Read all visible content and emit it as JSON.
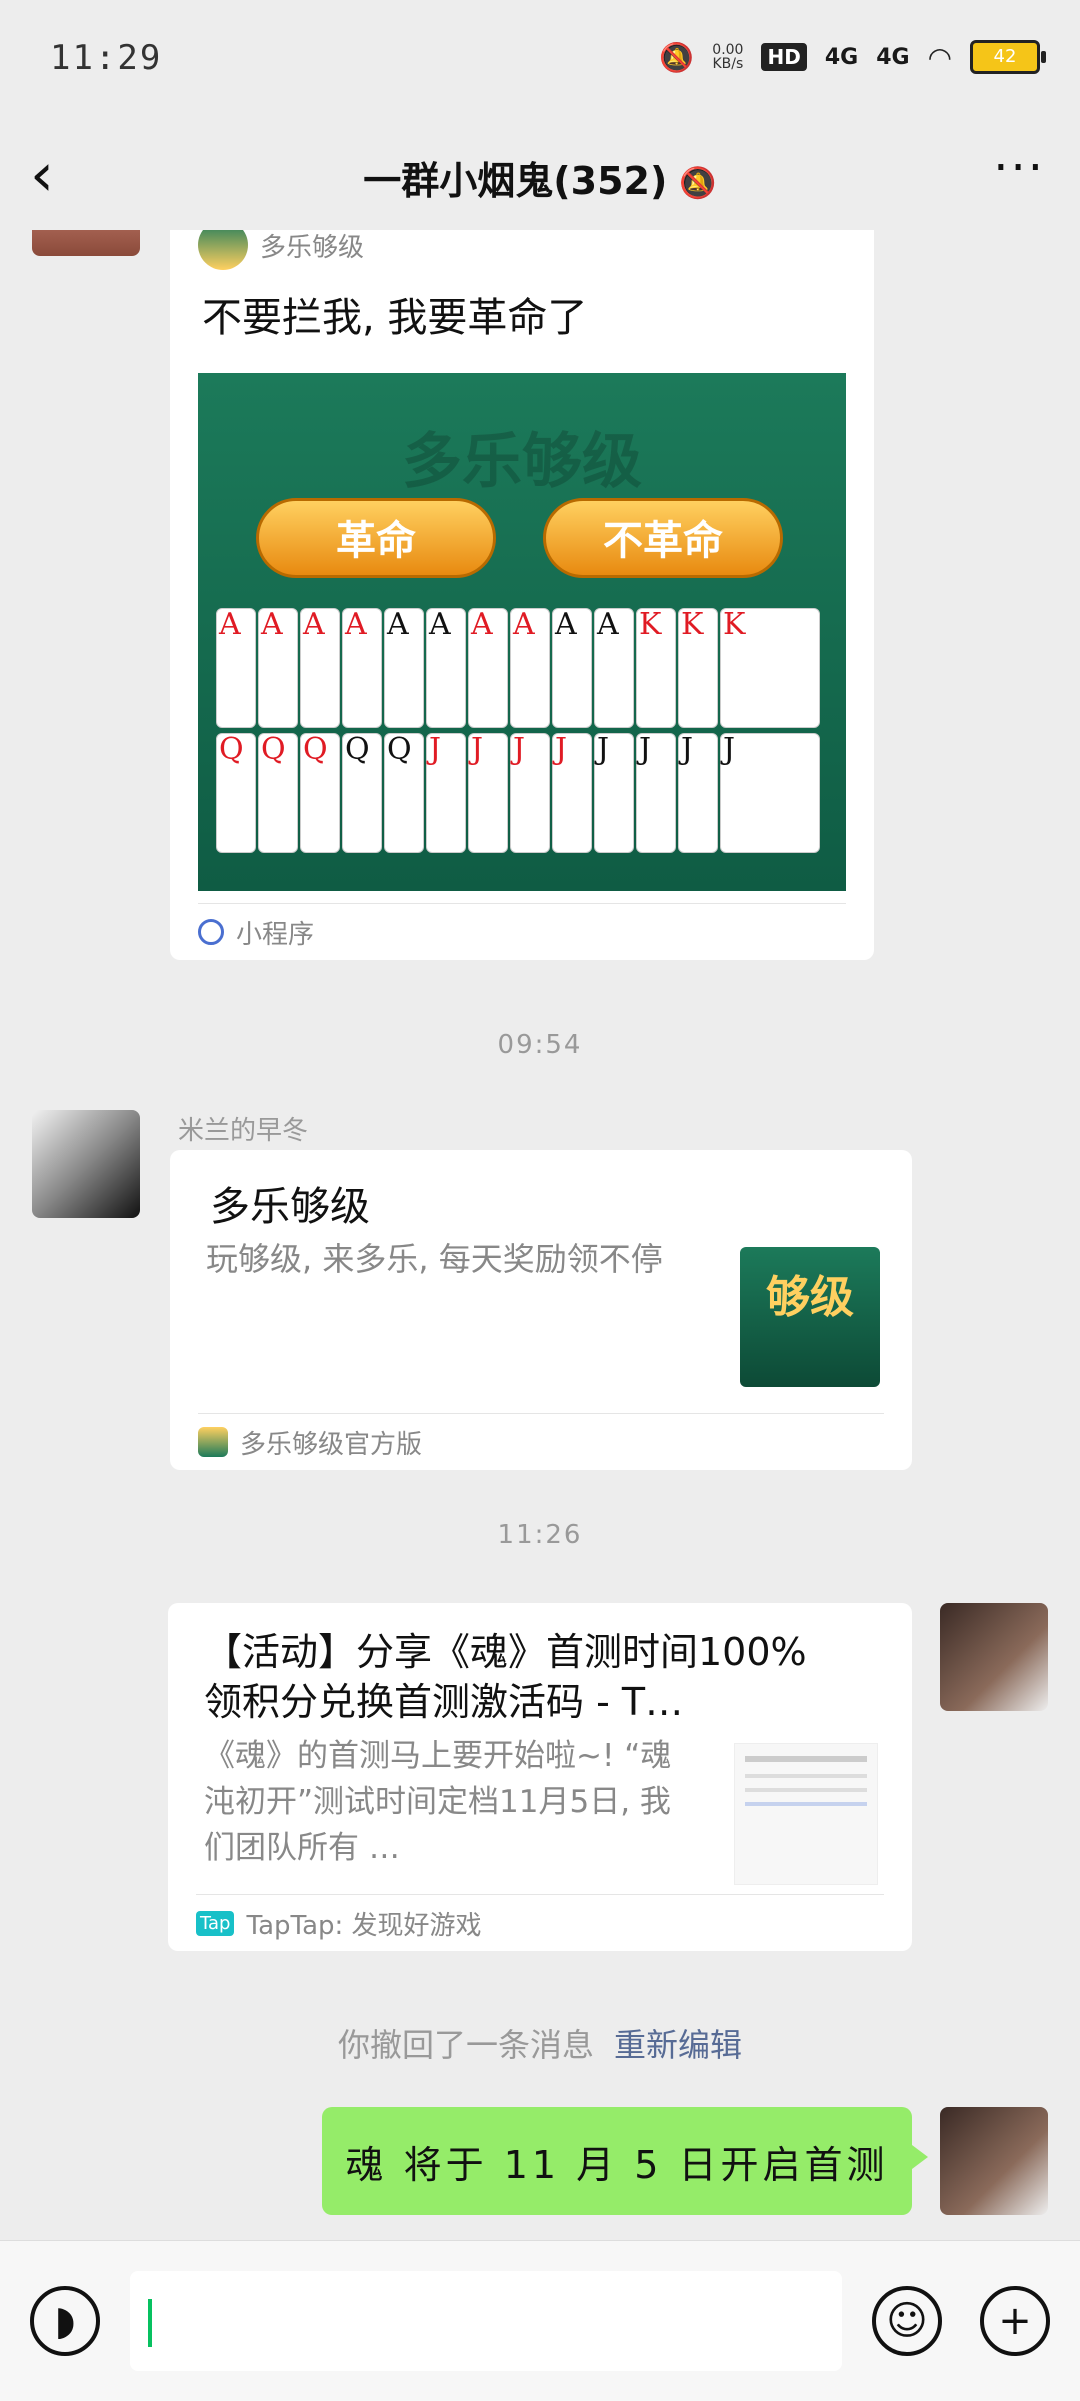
{
  "status_bar": {
    "time": "11:29",
    "net_speed": "0.00",
    "net_unit": "KB/s",
    "hd": "HD",
    "signal_1": "4G",
    "signal_2": "4G",
    "battery": "42"
  },
  "nav": {
    "title": "一群小烟鬼(352)"
  },
  "messages": {
    "miniprogram": {
      "source_name": "多乐够级",
      "title": "不要拦我, 我要革命了",
      "btn_left": "革命",
      "btn_right": "不革命",
      "watermark": "多乐够级",
      "footer": "小程序",
      "row1": [
        "A",
        "A",
        "A",
        "A",
        "A",
        "A",
        "A",
        "A",
        "A",
        "A",
        "K",
        "K",
        "K"
      ],
      "row2": [
        "Q",
        "Q",
        "Q",
        "Q",
        "Q",
        "J",
        "J",
        "J",
        "J",
        "J",
        "J",
        "J",
        "J"
      ]
    },
    "time_1": "09:54",
    "app_card": {
      "sender": "米兰的早冬",
      "title": "多乐够级",
      "desc": "玩够级, 来多乐, 每天奖励领不停",
      "thumb_text": "够级",
      "footer": "多乐够级官方版"
    },
    "time_2": "11:26",
    "link_card": {
      "title": "【活动】分享《魂》首测时间100%领积分兑换首测激活码 - T…",
      "desc": "《魂》的首测马上要开始啦~! “魂沌初开”测试时间定档11月5日, 我们团队所有 …",
      "footer_logo": "Tap",
      "footer": "TapTap: 发现好游戏"
    },
    "recall": {
      "text": "你撤回了一条消息",
      "edit": "重新编辑"
    },
    "sent": {
      "text": "魂 将于 11 月 5 日开启首测"
    }
  },
  "colors": {
    "green_bubble": "#95ec69",
    "link": "#576b95",
    "cursor": "#07c160"
  }
}
